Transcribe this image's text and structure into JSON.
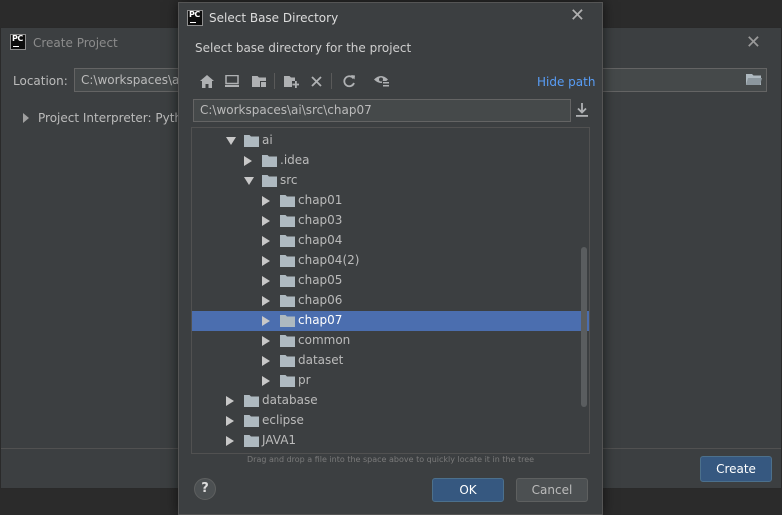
{
  "background_window": {
    "title": "Create Project",
    "close_glyph": "✕",
    "location_label": "Location:",
    "location_value": "C:\\workspaces\\ai",
    "interpreter_label": "Project Interpreter: Python",
    "create_label": "Create"
  },
  "dialog": {
    "title": "Select Base Directory",
    "close_glyph": "✕",
    "description": "Select base directory for the project",
    "toolbar_icons": [
      "home-icon",
      "desktop-icon",
      "project-folder-icon",
      "new-folder-icon",
      "delete-icon",
      "refresh-icon",
      "show-hidden-icon"
    ],
    "hide_path_label": "Hide path",
    "path_value": "C:\\workspaces\\ai\\src\\chap07",
    "hint": "Drag and drop a file into the space above to quickly locate it in the tree",
    "help_label": "?",
    "ok_label": "OK",
    "cancel_label": "Cancel",
    "tree": [
      {
        "label": "ai",
        "level": 0,
        "state": "expanded",
        "selected": false
      },
      {
        "label": ".idea",
        "level": 1,
        "state": "collapsed",
        "selected": false
      },
      {
        "label": "src",
        "level": 1,
        "state": "expanded",
        "selected": false
      },
      {
        "label": "chap01",
        "level": 2,
        "state": "collapsed",
        "selected": false
      },
      {
        "label": "chap03",
        "level": 2,
        "state": "collapsed",
        "selected": false
      },
      {
        "label": "chap04",
        "level": 2,
        "state": "collapsed",
        "selected": false
      },
      {
        "label": "chap04(2)",
        "level": 2,
        "state": "collapsed",
        "selected": false
      },
      {
        "label": "chap05",
        "level": 2,
        "state": "collapsed",
        "selected": false
      },
      {
        "label": "chap06",
        "level": 2,
        "state": "collapsed",
        "selected": false
      },
      {
        "label": "chap07",
        "level": 2,
        "state": "collapsed",
        "selected": true
      },
      {
        "label": "common",
        "level": 2,
        "state": "collapsed",
        "selected": false
      },
      {
        "label": "dataset",
        "level": 2,
        "state": "collapsed",
        "selected": false
      },
      {
        "label": "pr",
        "level": 2,
        "state": "collapsed",
        "selected": false
      },
      {
        "label": "database",
        "level": 0,
        "state": "collapsed",
        "selected": false
      },
      {
        "label": "eclipse",
        "level": 0,
        "state": "collapsed",
        "selected": false
      },
      {
        "label": "JAVA1",
        "level": 0,
        "state": "collapsed",
        "selected": false
      }
    ]
  },
  "colors": {
    "dialog_bg": "#3c3f41",
    "selection": "#4b6eaf",
    "link": "#589df6",
    "primary_button": "#365880",
    "folder": "#aeb9c0"
  }
}
